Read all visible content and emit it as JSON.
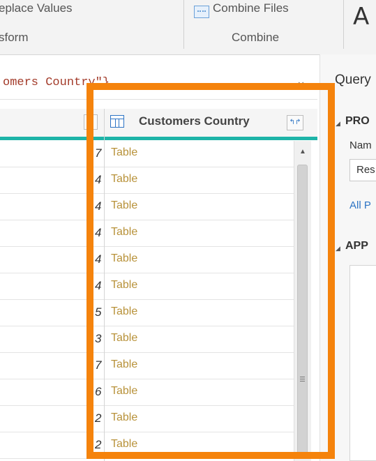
{
  "ribbon": {
    "replace_values_label": "eplace Values",
    "combine_files_label": "Combine Files",
    "transform_group_label": "sform",
    "combine_group_label": "Combine",
    "partial_icon_glyph": "A"
  },
  "formula_bar": {
    "text": "omers Country\"}",
    "chevron": "⌄"
  },
  "grid": {
    "column_header": "Customers Country",
    "expand_icon": "↰↱",
    "rows": [
      {
        "num": "7",
        "value": "Table"
      },
      {
        "num": "4",
        "value": "Table"
      },
      {
        "num": "4",
        "value": "Table"
      },
      {
        "num": "4",
        "value": "Table"
      },
      {
        "num": "4",
        "value": "Table"
      },
      {
        "num": "4",
        "value": "Table"
      },
      {
        "num": "5",
        "value": "Table"
      },
      {
        "num": "3",
        "value": "Table"
      },
      {
        "num": "7",
        "value": "Table"
      },
      {
        "num": "6",
        "value": "Table"
      },
      {
        "num": "2",
        "value": "Table"
      },
      {
        "num": "2",
        "value": "Table"
      }
    ]
  },
  "query_panel": {
    "title": "Query",
    "properties_label": "PRO",
    "name_label": "Nam",
    "name_value": "Res",
    "all_properties_link": "All P",
    "applied_steps_label": "APP",
    "caret": "◢"
  },
  "colors": {
    "highlight": "#f5830c",
    "teal_header_line": "#1eb4a8",
    "table_link": "#b8923a",
    "accent_blue": "#2d74c4"
  }
}
